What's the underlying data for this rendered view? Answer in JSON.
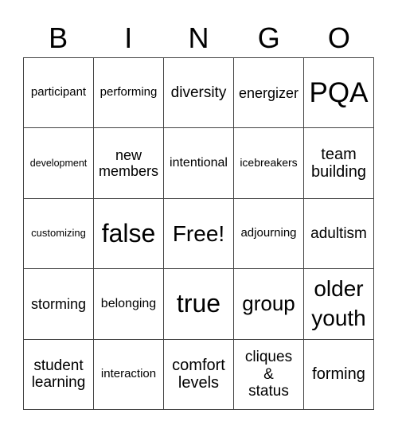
{
  "header": [
    "B",
    "I",
    "N",
    "G",
    "O"
  ],
  "rows": [
    [
      "participant",
      "performing",
      "diversity",
      "energizer",
      "PQA"
    ],
    [
      "development",
      "new members",
      "intentional",
      "icebreakers",
      "team building"
    ],
    [
      "customizing",
      "false",
      "Free!",
      "adjourning",
      "adultism"
    ],
    [
      "storming",
      "belonging",
      "true",
      "group",
      "older youth"
    ],
    [
      "student learning",
      "interaction",
      "comfort levels",
      "cliques & status",
      "forming"
    ]
  ],
  "free_space": "Free!"
}
